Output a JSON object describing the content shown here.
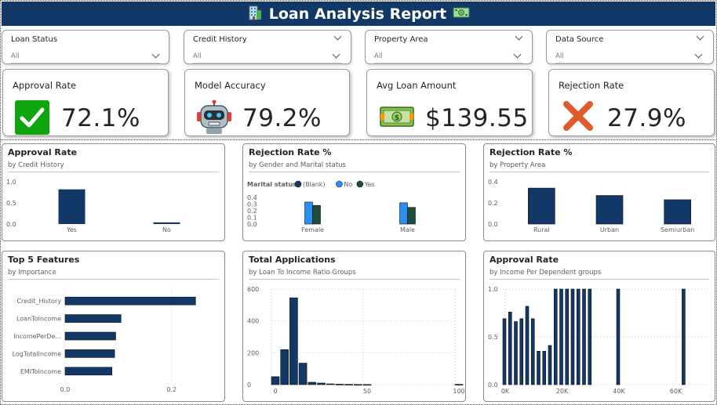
{
  "header": {
    "title": "Loan Analysis Report",
    "left_icon": "office-building-emoji",
    "right_icon": "money-banknote-emoji"
  },
  "slicers": [
    {
      "label": "Loan Status",
      "value": "All"
    },
    {
      "label": "Credit History",
      "value": "All"
    },
    {
      "label": "Property Area",
      "value": "All"
    },
    {
      "label": "Data Source",
      "value": "All"
    }
  ],
  "kpis": [
    {
      "label": "Approval Rate",
      "value": "72.1%",
      "icon": "check-mark-icon",
      "color": "#0ea50e"
    },
    {
      "label": "Model Accuracy",
      "value": "79.2%",
      "icon": "robot-icon"
    },
    {
      "label": "Avg Loan Amount",
      "value": "$139.55",
      "icon": "money-icon"
    },
    {
      "label": "Rejection Rate",
      "value": "27.9%",
      "icon": "cross-mark-icon",
      "color": "#e05a2b"
    }
  ],
  "colors": {
    "primary": "#123868",
    "blank": "#123868",
    "no": "#2a8ff5",
    "yes": "#1e4d3a",
    "header_bg": "#123868"
  },
  "chart_data": [
    {
      "type": "bar",
      "title": "Approval Rate",
      "subtitle": "by Credit History",
      "categories": [
        "Yes",
        "No"
      ],
      "values": [
        0.82,
        0.04
      ],
      "ylim": [
        0,
        1.0
      ],
      "yticks": [
        "1.0",
        "0.5",
        "0.0"
      ]
    },
    {
      "type": "bar",
      "title": "Rejection Rate %",
      "subtitle": "by Gender and Marital status",
      "legend_title": "Marital status",
      "categories": [
        "Female",
        "Male"
      ],
      "series": [
        {
          "name": "(Blank)",
          "values": [
            0,
            0
          ]
        },
        {
          "name": "No",
          "values": [
            0.33,
            0.32
          ]
        },
        {
          "name": "Yes",
          "values": [
            0.28,
            0.25
          ]
        }
      ],
      "ylim": [
        0,
        0.4
      ],
      "yticks": [
        "0.4",
        "0.2",
        "0.0"
      ]
    },
    {
      "type": "bar",
      "title": "Rejection Rate %",
      "subtitle": "by Property Area",
      "categories": [
        "Rural",
        "Urban",
        "Semiurban"
      ],
      "values": [
        0.34,
        0.27,
        0.23
      ],
      "ylim": [
        0,
        0.4
      ],
      "yticks": [
        "0.4",
        "0.2",
        "0.0"
      ]
    },
    {
      "type": "bar",
      "orientation": "horizontal",
      "title": "Top 5 Features",
      "subtitle": "by Importance",
      "categories": [
        "Credit_History",
        "LoanToIncome",
        "IncomePerDe...",
        "LogTotalIncome",
        "EMIToIncome"
      ],
      "values": [
        0.245,
        0.105,
        0.095,
        0.093,
        0.088
      ],
      "xlim": [
        0,
        0.28
      ],
      "xticks": [
        "0.0",
        "0.2"
      ]
    },
    {
      "type": "bar",
      "title": "Total Applications",
      "subtitle": "by Loan To Income Ratio Groups",
      "x": [
        0,
        5,
        10,
        15,
        20,
        25,
        30,
        35,
        40,
        45,
        50,
        100
      ],
      "values": [
        50,
        220,
        545,
        135,
        15,
        10,
        5,
        3,
        2,
        1,
        1,
        2
      ],
      "ylim": [
        0,
        600
      ],
      "yticks": [
        "600",
        "400",
        "200",
        "0"
      ],
      "xticks": [
        "0",
        "50",
        "100"
      ]
    },
    {
      "type": "bar",
      "title": "Approval Rate",
      "subtitle": "by Income Per Dependent groups",
      "x": [
        0,
        2000,
        4000,
        6000,
        8000,
        10000,
        12000,
        14000,
        16000,
        18000,
        20000,
        22000,
        24000,
        26000,
        28000,
        30000,
        40000,
        63000
      ],
      "values": [
        0.69,
        0.76,
        0.66,
        0.69,
        0.82,
        0.69,
        0.35,
        0.35,
        0.41,
        1.0,
        1.0,
        1.0,
        1.0,
        1.0,
        1.0,
        1.0,
        1.0,
        1.0
      ],
      "ylim": [
        0,
        1.0
      ],
      "yticks": [
        "1.0",
        "0.5",
        "0.0"
      ],
      "xticks": [
        "0K",
        "20K",
        "40K",
        "60K"
      ]
    }
  ]
}
